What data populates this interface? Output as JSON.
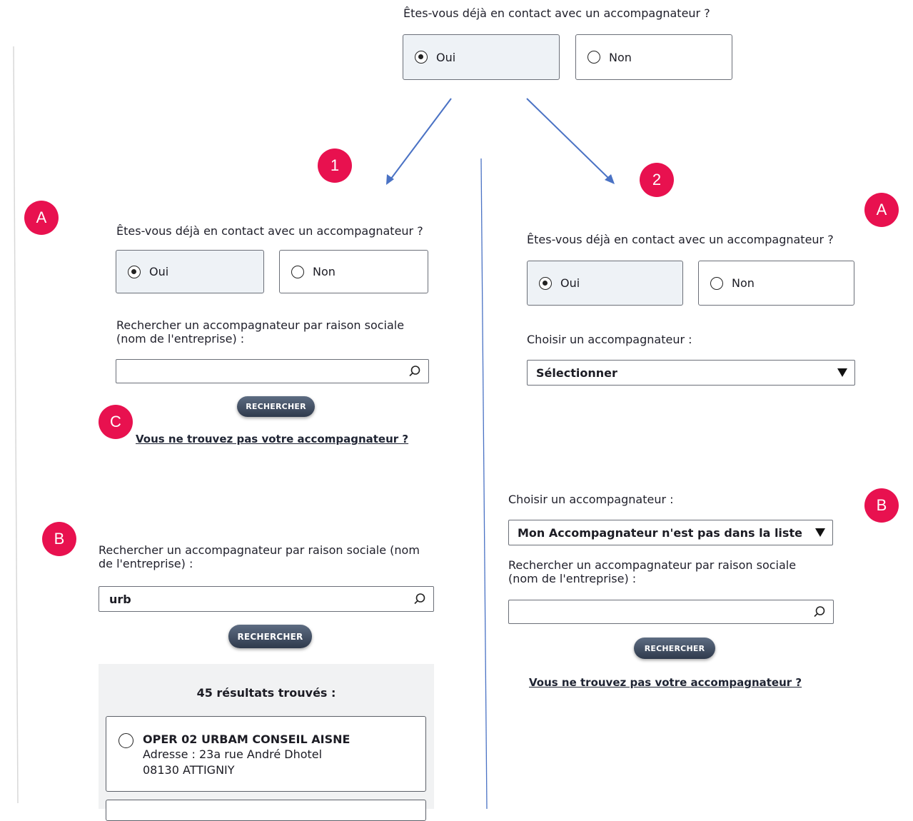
{
  "top": {
    "question": "Êtes-vous déjà en contact avec un accompagnateur ?",
    "options": [
      "Oui",
      "Non"
    ],
    "selected": "Oui"
  },
  "badges": {
    "n1": "1",
    "n2": "2",
    "a_left": "A",
    "a_right": "A",
    "b_left": "B",
    "b_right": "B",
    "c": "C"
  },
  "left_a": {
    "question": "Êtes-vous déjà en contact avec un accompagnateur ?",
    "options": [
      "Oui",
      "Non"
    ],
    "search_label": "Rechercher un accompagnateur par raison sociale (nom de l'entreprise) :",
    "search_value": "",
    "button": "RECHERCHER",
    "link": "Vous ne trouvez pas votre accompagnateur ?"
  },
  "left_b": {
    "search_label": "Rechercher un accompagnateur par raison sociale (nom de l'entreprise) :",
    "search_value": "urb",
    "button": "RECHERCHER",
    "results_count": "45 résultats trouvés :",
    "results": [
      {
        "name": "OPER 02 URBAM CONSEIL AISNE",
        "address": "Adresse : 23a rue André Dhotel",
        "city": "08130 ATTIGNIY"
      }
    ]
  },
  "right_a": {
    "question": "Êtes-vous déjà en contact avec un accompagnateur ?",
    "options": [
      "Oui",
      "Non"
    ],
    "choose_label": "Choisir un accompagnateur :",
    "select_value": "Sélectionner"
  },
  "right_b": {
    "choose_label": "Choisir un accompagnateur :",
    "select_value": "Mon Accompagnateur n'est pas dans la liste",
    "search_label": "Rechercher un accompagnateur par raison sociale (nom de l'entreprise) :",
    "search_value": "",
    "button": "RECHERCHER",
    "link": "Vous ne trouvez pas votre accompagnateur ?"
  },
  "colors": {
    "badge": "#e8114f",
    "arrow": "#4a72c4",
    "button": "#3a475c",
    "selected_bg": "#eef2f6"
  }
}
